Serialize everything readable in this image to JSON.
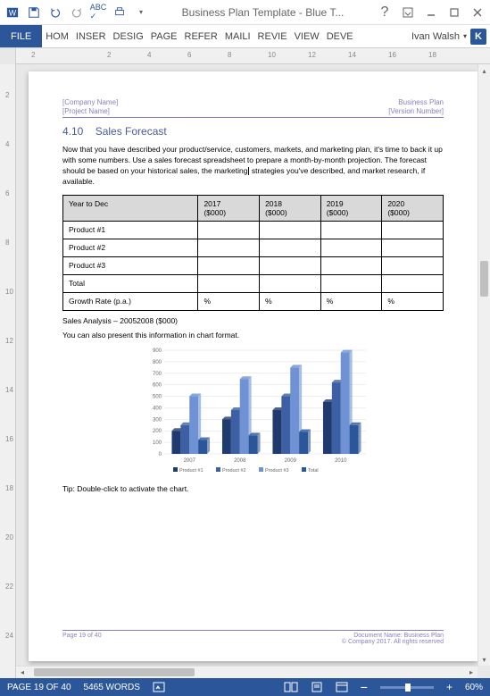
{
  "titlebar": {
    "title": "Business Plan Template - Blue T..."
  },
  "ribbon": {
    "file": "FILE",
    "tabs": [
      "HOM",
      "INSER",
      "DESIG",
      "PAGE",
      "REFER",
      "MAILI",
      "REVIE",
      "VIEW",
      "DEVE"
    ],
    "user": "Ivan Walsh",
    "user_initial": "K"
  },
  "ruler_h": [
    "2",
    "",
    "2",
    "4",
    "6",
    "8",
    "10",
    "12",
    "14",
    "16",
    "18"
  ],
  "ruler_v": [
    "2",
    "4",
    "6",
    "8",
    "10",
    "12",
    "14",
    "16",
    "18",
    "20",
    "22",
    "24"
  ],
  "document": {
    "header": {
      "company": "[Company Name]",
      "project": "[Project Name]",
      "plan": "Business Plan",
      "version": "[Version Number]"
    },
    "section_number": "4.10",
    "section_title": "Sales Forecast",
    "body1": "Now that you have described your product/service, customers, markets, and marketing plan, it's time to back it up with some numbers. Use a sales forecast spreadsheet to prepare a month-by-month projection. The forecast should be based on your historical sales, the marketing",
    "body1b": "strategies you've described, and market research, if available.",
    "table": {
      "cols": [
        {
          "h1": "Year to Dec",
          "h2": ""
        },
        {
          "h1": "2017",
          "h2": "($000)"
        },
        {
          "h1": "2018",
          "h2": "($000)"
        },
        {
          "h1": "2019",
          "h2": "($000)"
        },
        {
          "h1": "2020",
          "h2": "($000)"
        }
      ],
      "rows": [
        {
          "label": "Product #1",
          "cells": [
            "",
            "",
            "",
            ""
          ]
        },
        {
          "label": "Product #2",
          "cells": [
            "",
            "",
            "",
            ""
          ]
        },
        {
          "label": "Product #3",
          "cells": [
            "",
            "",
            "",
            ""
          ]
        },
        {
          "label": "Total",
          "cells": [
            "",
            "",
            "",
            ""
          ]
        },
        {
          "label": "Growth Rate (p.a.)",
          "cells": [
            "%",
            "%",
            "%",
            "%"
          ]
        }
      ]
    },
    "analysis_label": "Sales Analysis – 20052008 ($000)",
    "chart_note": "You can also present this information in chart format.",
    "chart_tip": "Tip: Double-click to activate the chart.",
    "footer": {
      "page": "Page 19 of 40",
      "docname": "Document Name: Business Plan",
      "copyright": "© Company 2017. All rights reserved"
    }
  },
  "chart_data": {
    "type": "bar",
    "categories": [
      "2007",
      "2008",
      "2009",
      "2010"
    ],
    "series": [
      {
        "name": "Product #1",
        "values": [
          200,
          300,
          380,
          450
        ],
        "color": "#1f3a6e"
      },
      {
        "name": "Product #2",
        "values": [
          250,
          380,
          500,
          620
        ],
        "color": "#3d5fa3"
      },
      {
        "name": "Product #3",
        "values": [
          500,
          650,
          750,
          880
        ],
        "color": "#6e92d4"
      },
      {
        "name": "Total",
        "values": [
          120,
          160,
          190,
          250
        ],
        "color": "#2b579a"
      }
    ],
    "ylim": [
      0,
      900
    ],
    "yticks": [
      0,
      100,
      200,
      300,
      400,
      500,
      600,
      700,
      800,
      900
    ],
    "xlabel": "",
    "ylabel": "",
    "title": ""
  },
  "statusbar": {
    "page": "PAGE 19 OF 40",
    "words": "5465 WORDS",
    "zoom": "60%"
  }
}
